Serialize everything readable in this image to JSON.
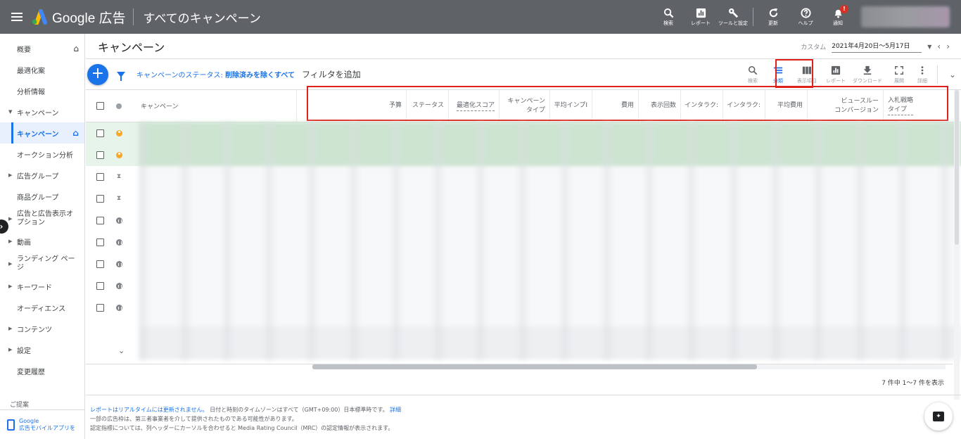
{
  "topbar": {
    "app_name": "Google 広告",
    "page_title": "すべてのキャンペーン",
    "actions": [
      {
        "label": "検索",
        "icon": "search-icon"
      },
      {
        "label": "レポート",
        "icon": "reports-icon"
      },
      {
        "label": "ツールと設定",
        "icon": "wrench-icon"
      },
      {
        "label": "更新",
        "icon": "refresh-icon"
      },
      {
        "label": "ヘルプ",
        "icon": "help-icon"
      },
      {
        "label": "通知",
        "icon": "bell-icon"
      }
    ],
    "notification_badge": "!"
  },
  "sidebar": {
    "items": [
      {
        "label": "概要"
      },
      {
        "label": "最適化案"
      },
      {
        "label": "分析情報"
      },
      {
        "label": "キャンペーン"
      },
      {
        "label": "キャンペーン"
      },
      {
        "label": "オークション分析"
      },
      {
        "label": "広告グループ"
      },
      {
        "label": "商品グループ"
      },
      {
        "label": "広告と広告表示オプション"
      },
      {
        "label": "動画"
      },
      {
        "label": "ランディング ページ"
      },
      {
        "label": "キーワード"
      },
      {
        "label": "オーディエンス"
      },
      {
        "label": "コンテンツ"
      },
      {
        "label": "設定"
      },
      {
        "label": "変更履歴"
      }
    ],
    "suggest_label": "ご提案",
    "promo": {
      "line1": "Google",
      "line2": "広告モバイルアプリを"
    }
  },
  "main": {
    "title": "キャンペーン",
    "date": {
      "custom_label": "カスタム",
      "range": "2021年4月20日～5月17日"
    },
    "filter": {
      "prefix": "キャンペーンのステータス: ",
      "value": "削除済みを除くすべて",
      "add_filter": "フィルタを追加"
    },
    "tools": [
      {
        "label": "検索"
      },
      {
        "label": "分類"
      },
      {
        "label": "表示項目"
      },
      {
        "label": "レポート"
      },
      {
        "label": "ダウンロード"
      },
      {
        "label": "展開"
      },
      {
        "label": "詳細"
      }
    ],
    "columns": {
      "campaign": "キャンペーン",
      "budget": "予算",
      "status": "ステータス",
      "opt_score": "最適化スコア",
      "campaign_type_1": "キャンペーン",
      "campaign_type_2": "タイプ",
      "avg_imp": "平均インプI",
      "cost": "費用",
      "impressions": "表示回数",
      "interactions1": "インタラク:",
      "interactions2": "インタラク:",
      "avg_cost": "平均費用",
      "view_conv_1": "ビュースルー",
      "view_conv_2": "コンバージョン",
      "bid_1": "入札戦略",
      "bid_2": "タイプ"
    },
    "count_text": "7 件中 1～7 件を表示"
  },
  "footer": {
    "line1_link": "レポートはリアルタイムには更新されません。",
    "line1_text": " 日付と時刻のタイムゾーンはすべて（GMT+09:00）日本標準時です。",
    "line1_more": "詳細",
    "line2": "一部の広告枠は、第三者事業者を介して提供されたものである可能性があります。",
    "line3": "認定指標については、列ヘッダーにカーソルを合わせると Media Rating Council（MRC）の認定情報が表示されます。"
  },
  "colors": {
    "topbar": "#5f6368",
    "accent": "#1a73e8",
    "highlight": "#e0201b"
  }
}
